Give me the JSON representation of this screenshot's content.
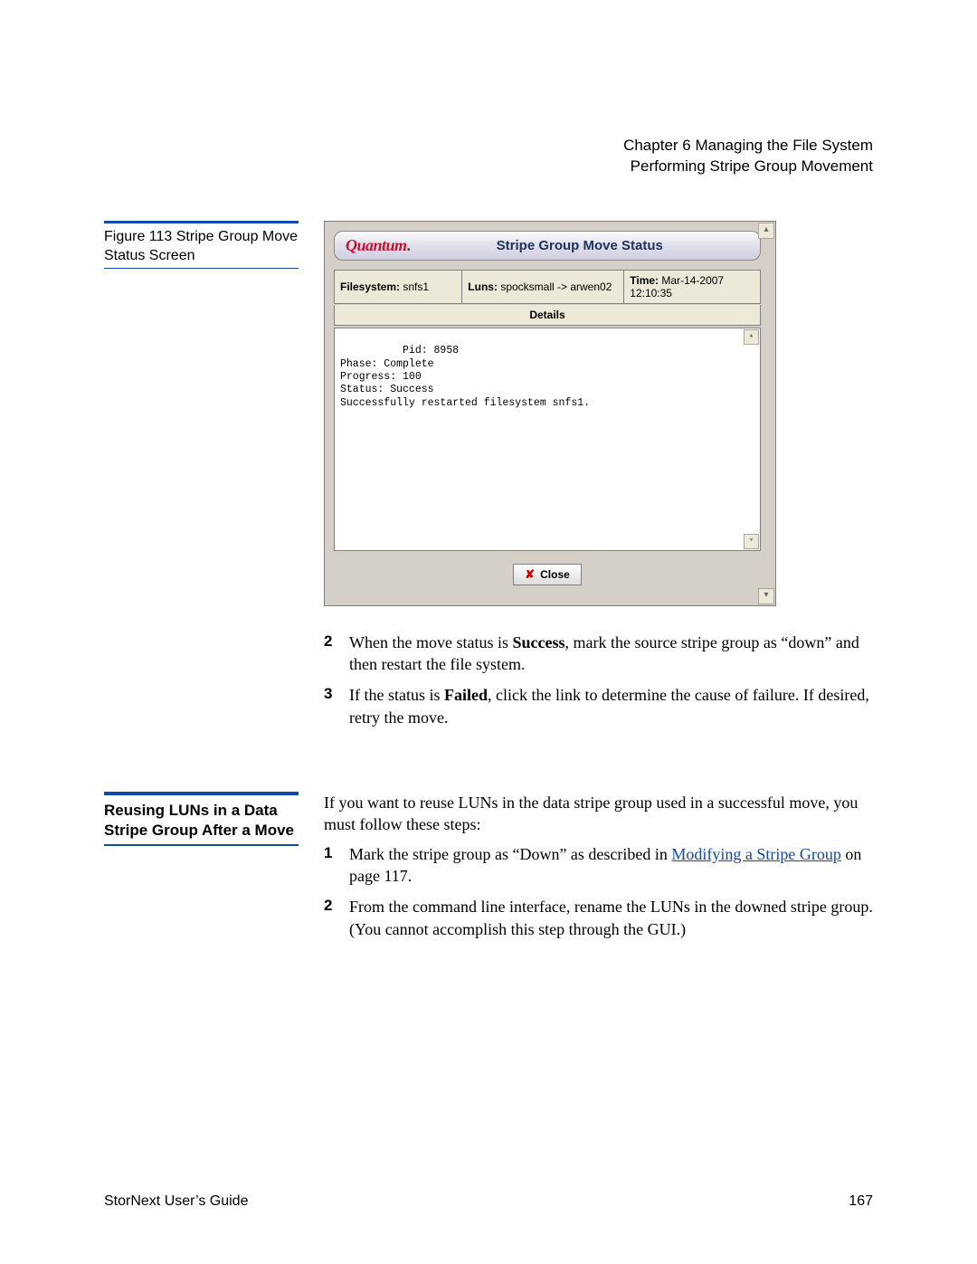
{
  "header": {
    "line1": "Chapter 6  Managing the File System",
    "line2": "Performing Stripe Group Movement"
  },
  "figure_caption": "Figure 113  Stripe Group Move Status Screen",
  "app": {
    "logo_text": "Quantum",
    "title": "Stripe Group Move Status",
    "filesystem_label": "Filesystem:",
    "filesystem_value": "snfs1",
    "luns_label": "Luns:",
    "luns_value": "spocksmall -> arwen02",
    "time_label": "Time:",
    "time_value": "Mar-14-2007 12:10:35",
    "details_label": "Details",
    "details_text": "Pid: 8958\nPhase: Complete\nProgress: 100\nStatus: Success\nSuccessfully restarted filesystem snfs1.",
    "close_label": "Close",
    "scroll_up_glyph": "▴",
    "scroll_down_glyph": "▾"
  },
  "steps_a": {
    "n2": "2",
    "p2_a": "When the move status is ",
    "p2_bold": "Success",
    "p2_b": ", mark the source stripe group as “down” and then restart the file system.",
    "n3": "3",
    "p3_a": "If the status is ",
    "p3_bold": "Failed",
    "p3_b": ", click the link to determine the cause of failure. If desired, retry the move."
  },
  "section2": {
    "heading": "Reusing LUNs in a Data Stripe Group After a Move",
    "intro": "If you want to reuse LUNs in the data stripe group used in a successful move, you must follow these steps:",
    "n1": "1",
    "p1_a": "Mark the stripe group as “Down” as described in ",
    "p1_link": "Modifying a Stripe Group",
    "p1_b": " on page  117.",
    "n2": "2",
    "p2": "From the command line interface, rename the LUNs in the downed stripe group. (You cannot accomplish this step through the GUI.)"
  },
  "footer": {
    "left": "StorNext User’s Guide",
    "right": "167"
  }
}
